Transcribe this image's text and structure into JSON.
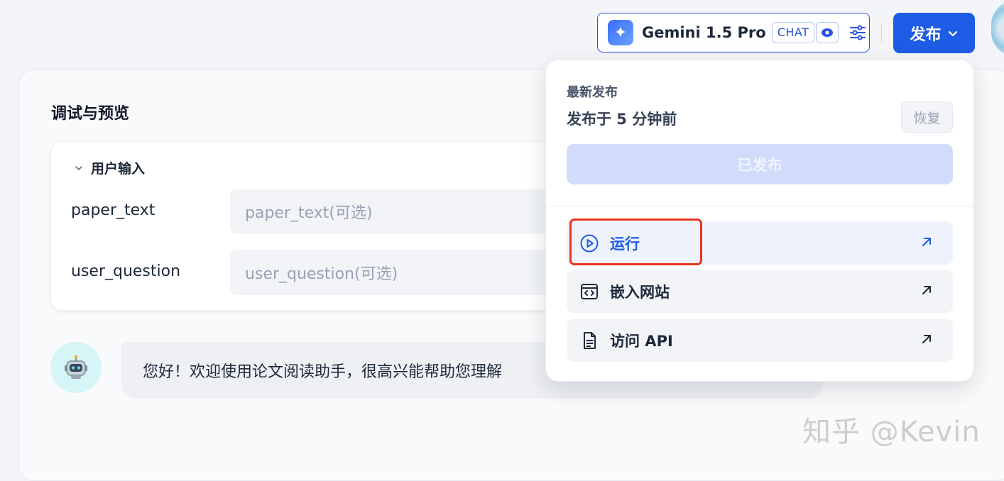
{
  "header": {
    "model": {
      "logo_glyph": "✦",
      "name": "Gemini 1.5 Pro",
      "mode_badge": "CHAT",
      "vision_icon": "eye-icon",
      "settings_icon": "sliders-icon"
    },
    "publish_button": "发布",
    "accent_color": "#1f5ce5"
  },
  "panel": {
    "title": "调试与预览",
    "user_input": {
      "section_title": "用户输入",
      "fields": [
        {
          "label": "paper_text",
          "placeholder": "paper_text(可选)",
          "value": ""
        },
        {
          "label": "user_question",
          "placeholder": "user_question(可选)",
          "value": ""
        }
      ]
    },
    "chat": {
      "avatar_icon": "robot-icon",
      "message": "您好！欢迎使用论文阅读助手，很高兴能帮助您理解"
    }
  },
  "publish_menu": {
    "caption": "最新发布",
    "published_time": "发布于 5 分钟前",
    "restore_label": "恢复",
    "published_state_label": "已发布",
    "items": [
      {
        "label": "运行",
        "icon": "play-circle-icon"
      },
      {
        "label": "嵌入网站",
        "icon": "embed-code-icon"
      },
      {
        "label": "访问 API",
        "icon": "document-icon"
      }
    ]
  },
  "watermark": "知乎 @Kevin"
}
